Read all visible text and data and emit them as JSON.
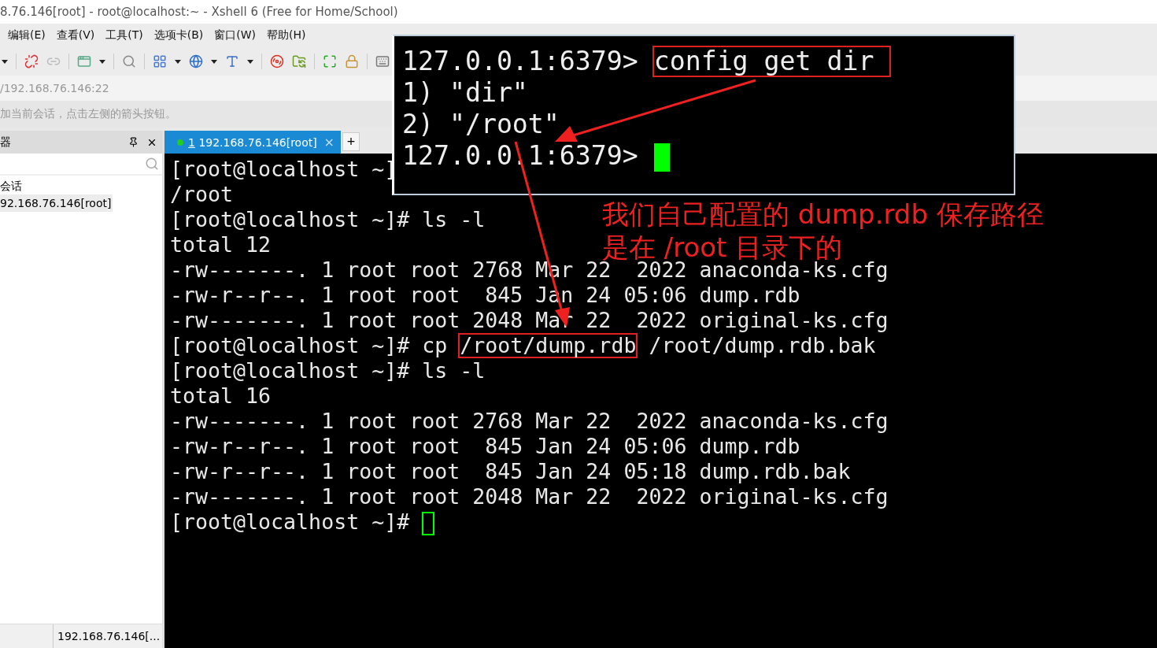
{
  "window": {
    "title": "8.76.146[root] - root@localhost:~ - Xshell 6 (Free for Home/School)"
  },
  "menu": [
    {
      "label": "编辑(E)"
    },
    {
      "label": "查看(V)"
    },
    {
      "label": "工具(T)"
    },
    {
      "label": "选项卡(B)"
    },
    {
      "label": "窗口(W)"
    },
    {
      "label": "帮助(H)"
    }
  ],
  "address": "/192.168.76.146:22",
  "hint": "加当前会话，点击左侧的箭头按钮。",
  "session_panel": {
    "title": "器",
    "items": [
      {
        "label": "会话",
        "selected": false,
        "children": [
          {
            "label": "92.168.76.146[root]",
            "selected": true
          }
        ]
      }
    ]
  },
  "tabs": [
    {
      "number": "1",
      "label": "192.168.76.146[root]",
      "selected": true,
      "connected": true,
      "close": "×"
    }
  ],
  "new_tab": "+",
  "terminal": {
    "cursor_focused": false,
    "lines": [
      [
        {
          "text": "[root@localhost ~]"
        }
      ],
      [
        {
          "text": "/root"
        }
      ],
      [
        {
          "text": "[root@localhost ~]# ls -l"
        }
      ],
      [
        {
          "text": "total 12"
        }
      ],
      [
        {
          "text": "-rw-------. 1 root root 2768 Mar 22  2022 anaconda-ks.cfg"
        }
      ],
      [
        {
          "text": "-rw-r--r--. 1 root root  845 Jan 24 05:06 dump.rdb"
        }
      ],
      [
        {
          "text": "-rw-------. 1 root root 2048 Mar 22  2022 original-ks.cfg"
        }
      ],
      [
        {
          "text": "[root@localhost ~]# cp "
        },
        {
          "text": "/root/dump.rdb",
          "boxed": true
        },
        {
          "text": " /root/dump.rdb.bak"
        }
      ],
      [
        {
          "text": "[root@localhost ~]# ls -l"
        }
      ],
      [
        {
          "text": "total 16"
        }
      ],
      [
        {
          "text": "-rw-------. 1 root root 2768 Mar 22  2022 anaconda-ks.cfg"
        }
      ],
      [
        {
          "text": "-rw-r--r--. 1 root root  845 Jan 24 05:06 dump.rdb"
        }
      ],
      [
        {
          "text": "-rw-r--r--. 1 root root  845 Jan 24 05:18 dump.rdb.bak"
        }
      ],
      [
        {
          "text": "-rw-------. 1 root root 2048 Mar 22  2022 original-ks.cfg"
        }
      ],
      [
        {
          "text": "[root@localhost ~]# ",
          "cursor": true
        }
      ]
    ]
  },
  "inset": {
    "cursor_focused": true,
    "lines": [
      [
        {
          "text": "127.0.0.1:6379> "
        },
        {
          "text": "config get dir",
          "boxed": true
        }
      ],
      [
        {
          "text": "1) \"dir\""
        }
      ],
      [
        {
          "text": "2) \"/root\""
        }
      ],
      [
        {
          "text": "127.0.0.1:6379> ",
          "cursor": true
        }
      ]
    ]
  },
  "annotation": {
    "lines": [
      "我们自己配置的 dump.rdb 保存路径",
      "是在 /root 目录下的"
    ]
  },
  "status_bar": {
    "cell": "192.168.76.146[..."
  }
}
